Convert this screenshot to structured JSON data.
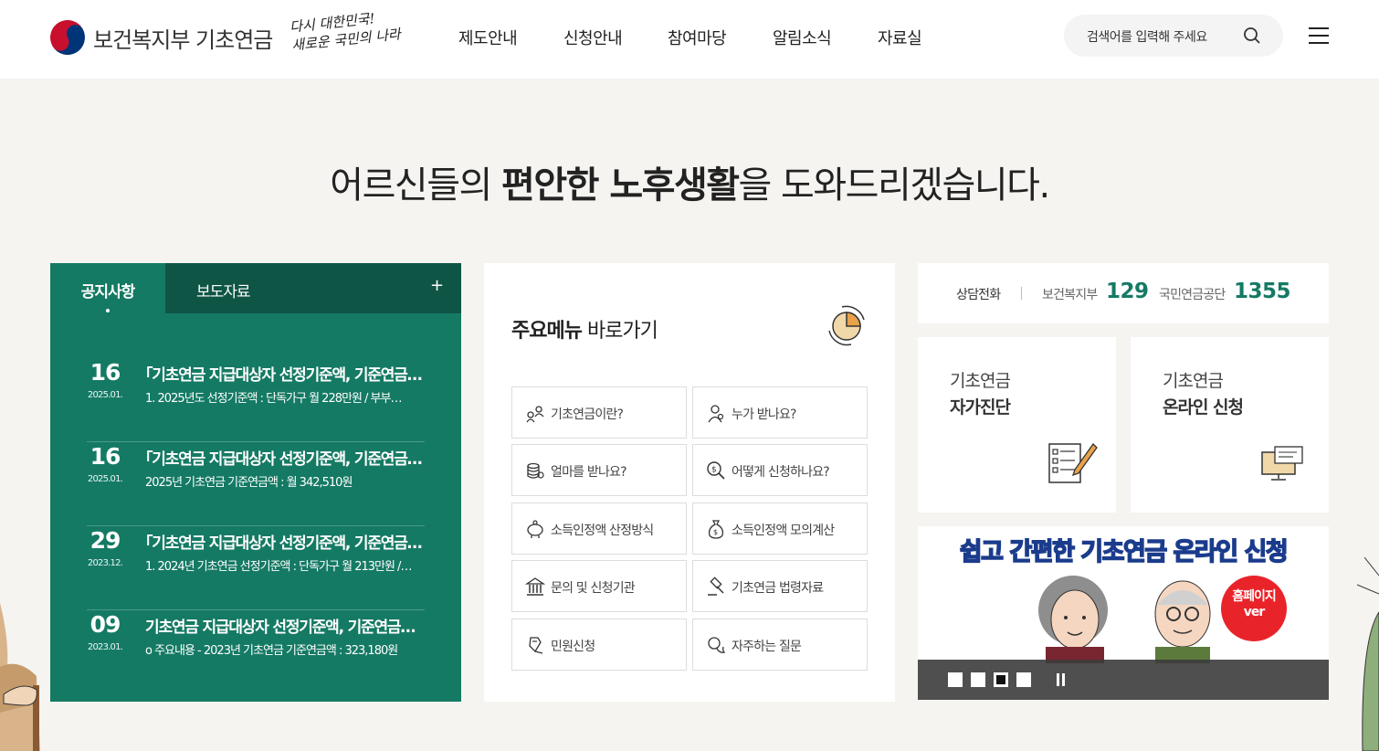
{
  "header": {
    "logo_text": "보건복지부 기초연금",
    "slogan_line1": "다시 대한민국!",
    "slogan_line2": "새로운 국민의 나라",
    "nav": [
      "제도안내",
      "신청안내",
      "참여마당",
      "알림소식",
      "자료실"
    ],
    "search_placeholder": "검색어를 입력해 주세요",
    "icons": {
      "search": "search-icon",
      "menu": "hamburger-menu-icon"
    }
  },
  "hero": {
    "prefix": "어르신들의 ",
    "emphasis": "편안한 노후생활",
    "suffix": "을 도와드리겠습니다."
  },
  "notice": {
    "tabs": [
      "공지사항",
      "보도자료"
    ],
    "more": "+",
    "items": [
      {
        "day": "16",
        "date": "2025.01.",
        "title": "｢기초연금 지급대상자 선정기준액, 기준연금…",
        "summary": "1. 2025년도 선정기준액 : 단독가구 월 228만원 / 부부…"
      },
      {
        "day": "16",
        "date": "2025.01.",
        "title": "｢기초연금 지급대상자 선정기준액, 기준연금…",
        "summary": "2025년 기초연금 기준연금액 : 월 342,510원"
      },
      {
        "day": "29",
        "date": "2023.12.",
        "title": "｢기초연금 지급대상자 선정기준액, 기준연금…",
        "summary": "1. 2024년 기초연금 선정기준액 : 단독가구 월 213만원 /…"
      },
      {
        "day": "09",
        "date": "2023.01.",
        "title": "기초연금 지급대상자 선정기준액, 기준연금액…",
        "summary": "o 주요내용 - 2023년 기초연금 기준연금액 : 323,180원"
      }
    ]
  },
  "main_menu": {
    "title_bold": "주요메뉴",
    "title_rest": " 바로가기",
    "items": [
      {
        "label": "기초연금이란?",
        "icon": "people-coins-icon"
      },
      {
        "label": "누가 받나요?",
        "icon": "person-search-icon"
      },
      {
        "label": "얼마를 받나요?",
        "icon": "coin-stack-icon"
      },
      {
        "label": "어떻게 신청하나요?",
        "icon": "magnifier-money-icon"
      },
      {
        "label": "소득인정액 산정방식",
        "icon": "piggy-bank-icon"
      },
      {
        "label": "소득인정액 모의계산",
        "icon": "money-bag-icon"
      },
      {
        "label": "문의 및 신청기관",
        "icon": "institution-icon"
      },
      {
        "label": "기초연금 법령자료",
        "icon": "gavel-icon"
      },
      {
        "label": "민원신청",
        "icon": "hand-document-icon"
      },
      {
        "label": "자주하는 질문",
        "icon": "chat-bubbles-icon"
      }
    ]
  },
  "contact": {
    "label": "상담전화",
    "org1": "보건복지부",
    "num1": "129",
    "org2": "국민연금공단",
    "num2": "1355"
  },
  "cards": [
    {
      "line1": "기초연금",
      "line2": "자가진단",
      "icon": "checklist-pencil-icon"
    },
    {
      "line1": "기초연금",
      "line2": "온라인 신청",
      "icon": "computer-monitor-icon"
    }
  ],
  "banner": {
    "title": "쉽고 간편한 기초연금 온라인 신청",
    "badge_line1": "홈페이지",
    "badge_line2": "ver",
    "slide_count": 4,
    "active_slide": 3
  },
  "colors": {
    "primary_green": "#157a64",
    "dark_green": "#0e5545",
    "background": "#f5f4f1"
  }
}
